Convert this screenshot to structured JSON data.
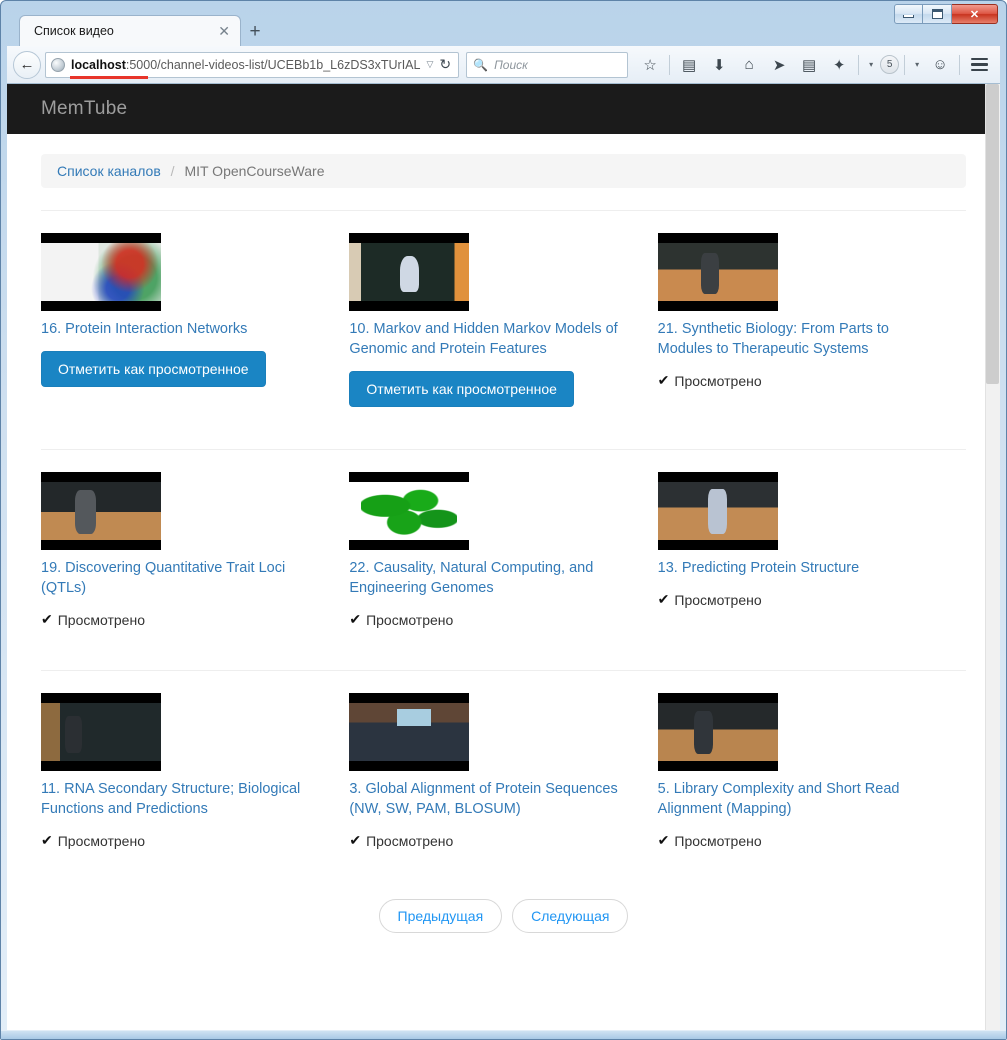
{
  "browser": {
    "tab": {
      "title": "Список видео",
      "close_glyph": "✕"
    },
    "new_tab_glyph": "+",
    "window_controls": {
      "minimize": "—",
      "maximize": "❐",
      "close": "✕"
    },
    "back_glyph": "←",
    "url": {
      "host": "localhost",
      "rest": ":5000/channel-videos-list/UCEBb1b_L6zDS3xTUrIAL"
    },
    "url_dropdown_glyph": "▽",
    "reload_glyph": "↻",
    "search": {
      "placeholder": "Поиск",
      "icon_glyph": "🔍"
    },
    "toolbar_icons": [
      {
        "name": "bookmark-star-icon",
        "glyph": "☆"
      },
      {
        "name": "reading-list-icon",
        "glyph": "▤"
      },
      {
        "name": "downloads-icon",
        "glyph": "⬇"
      },
      {
        "name": "home-icon",
        "glyph": "⌂"
      },
      {
        "name": "pocket-send-icon",
        "glyph": "➤"
      },
      {
        "name": "notepad-edit-icon",
        "glyph": "▤"
      },
      {
        "name": "bug-addon-icon",
        "glyph": "✦"
      },
      {
        "name": "badge-count",
        "glyph": "5"
      },
      {
        "name": "smiley-feedback-icon",
        "glyph": "☺"
      }
    ],
    "caret_glyph": "▾"
  },
  "site": {
    "brand": "MemTube",
    "breadcrumb": {
      "link_label": "Список каналов",
      "separator": "/",
      "current": "MIT OpenCourseWare"
    },
    "labels": {
      "mark_watched": "Отметить как просмотренное",
      "watched": "Просмотрено",
      "check_glyph": "✔"
    },
    "pagination": {
      "previous": "Предыдущая",
      "next": "Следующая"
    },
    "colors": {
      "link": "#337ab7",
      "button_primary": "#1a85c4",
      "navbar_bg": "#1b1b1b",
      "brand_text": "#9d9d9d",
      "breadcrumb_bg": "#f5f5f5",
      "pager_link": "#2196f3"
    },
    "videos": [
      {
        "title": "16. Protein Interaction Networks",
        "watched": false,
        "thumb_class": "t1"
      },
      {
        "title": "10. Markov and Hidden Markov Models of Genomic and Protein Features",
        "watched": false,
        "thumb_class": "t2"
      },
      {
        "title": "21. Synthetic Biology: From Parts to Modules to Therapeutic Systems",
        "watched": true,
        "thumb_class": "t3"
      },
      {
        "title": "19. Discovering Quantitative Trait Loci (QTLs)",
        "watched": true,
        "thumb_class": "t4"
      },
      {
        "title": "22. Causality, Natural Computing, and Engineering Genomes",
        "watched": true,
        "thumb_class": "t5"
      },
      {
        "title": "13. Predicting Protein Structure",
        "watched": true,
        "thumb_class": "t6"
      },
      {
        "title": "11. RNA Secondary Structure; Biological Functions and Predictions",
        "watched": true,
        "thumb_class": "t7"
      },
      {
        "title": "3. Global Alignment of Protein Sequences (NW, SW, PAM, BLOSUM)",
        "watched": true,
        "thumb_class": "t8"
      },
      {
        "title": "5. Library Complexity and Short Read Alignment (Mapping)",
        "watched": true,
        "thumb_class": "t9"
      }
    ]
  }
}
